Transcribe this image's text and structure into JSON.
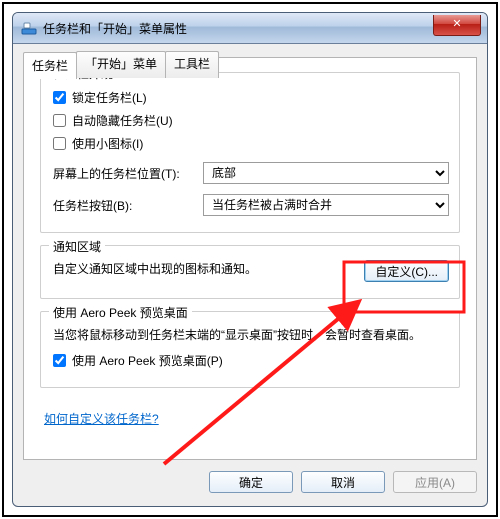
{
  "window": {
    "title": "任务栏和「开始」菜单属性",
    "close_glyph": "✕"
  },
  "tabs": {
    "taskbar": "任务栏",
    "start_menu": "「开始」菜单",
    "toolbars": "工具栏"
  },
  "appearance": {
    "legend": "任务栏外观",
    "lock": "锁定任务栏(L)",
    "autohide": "自动隐藏任务栏(U)",
    "small_icons": "使用小图标(I)",
    "position_label": "屏幕上的任务栏位置(T):",
    "position_value": "底部",
    "buttons_label": "任务栏按钮(B):",
    "buttons_value": "当任务栏被占满时合并"
  },
  "notification": {
    "legend": "通知区域",
    "desc": "自定义通知区域中出现的图标和通知。",
    "customize_btn": "自定义(C)..."
  },
  "aero": {
    "legend": "使用 Aero Peek 预览桌面",
    "desc": "当您将鼠标移动到任务栏末端的“显示桌面”按钮时，会暂时查看桌面。",
    "checkbox": "使用 Aero Peek 预览桌面(P)"
  },
  "help_link": "如何自定义该任务栏?",
  "buttons": {
    "ok": "确定",
    "cancel": "取消",
    "apply": "应用(A)"
  },
  "state": {
    "lock_checked": true,
    "autohide_checked": false,
    "small_icons_checked": false,
    "aero_checked": true
  }
}
